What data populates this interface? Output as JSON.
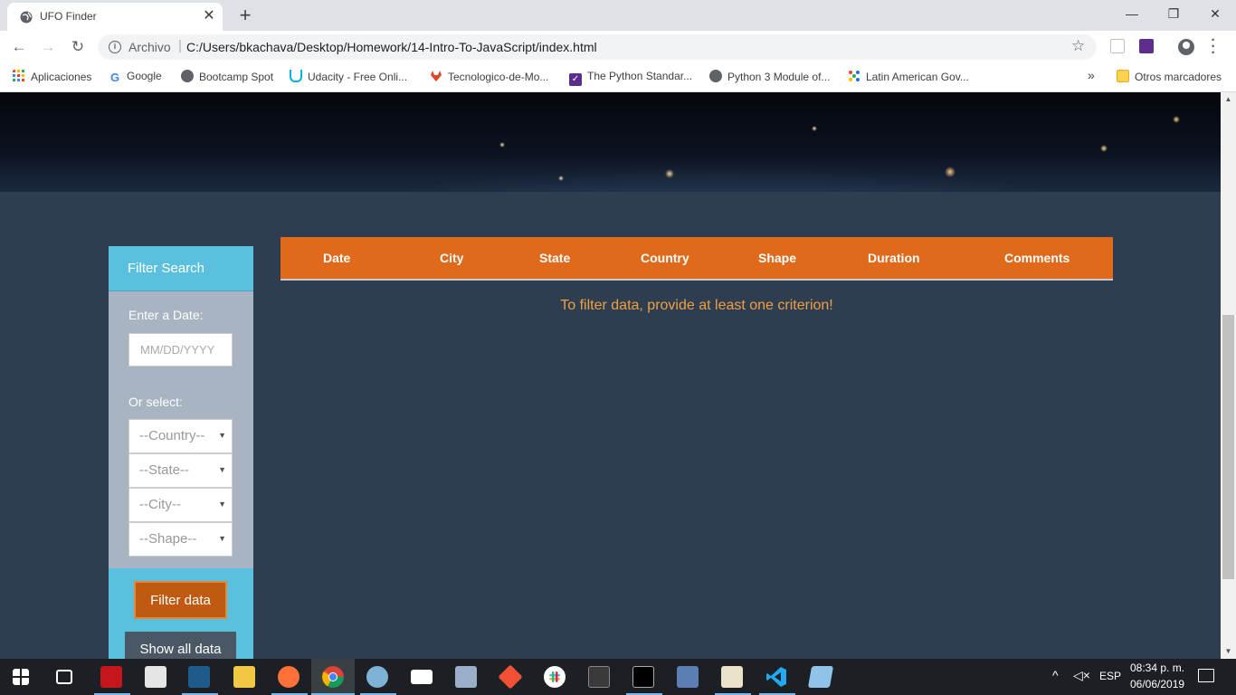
{
  "browser": {
    "tab_title": "UFO Finder",
    "tab_close": "✕",
    "new_tab": "+",
    "win_minimize": "—",
    "win_restore": "❐",
    "win_close": "✕",
    "address_scheme": "Archivo",
    "address_url": "C:/Users/bkachava/Desktop/Homework/14-Intro-To-JavaScript/index.html",
    "bookmarks": [
      {
        "label": "Aplicaciones",
        "icon": "apps-grid-icon",
        "color": "#ea4335"
      },
      {
        "label": "Google",
        "icon": "google-icon",
        "color": "#4285f4"
      },
      {
        "label": "Bootcamp Spot",
        "icon": "globe-icon",
        "color": "#5f6368"
      },
      {
        "label": "Udacity - Free Onli...",
        "icon": "udacity-icon",
        "color": "#02b3e4"
      },
      {
        "label": "Tecnologico-de-Mo...",
        "icon": "gitlab-icon",
        "color": "#e24329"
      },
      {
        "label": "The Python Standar...",
        "icon": "checkmark-icon",
        "color": "#5b2d8e"
      },
      {
        "label": "Python 3 Module of...",
        "icon": "globe-icon",
        "color": "#5f6368"
      },
      {
        "label": "Latin American Gov...",
        "icon": "dots-icon",
        "color": "#1a73e8"
      }
    ],
    "bookmarks_overflow": "»",
    "other_bookmarks": "Otros marcadores"
  },
  "filter": {
    "header": "Filter Search",
    "date_label": "Enter a Date:",
    "date_placeholder": "MM/DD/YYYY",
    "select_label": "Or select:",
    "selects": [
      "--Country--",
      "--State--",
      "--City--",
      "--Shape--"
    ],
    "filter_button": "Filter data",
    "show_all_button": "Show all data"
  },
  "table": {
    "headers": [
      "Date",
      "City",
      "State",
      "Country",
      "Shape",
      "Duration",
      "Comments"
    ],
    "empty_message": "To filter data, provide at least one criterion!"
  },
  "taskbar": {
    "language": "ESP",
    "time": "08:34 p. m.",
    "date": "06/06/2019"
  },
  "colors": {
    "page_bg": "#2e3e50",
    "header_orange": "#e06a1c",
    "panel_blue": "#5bc0de",
    "message_orange": "#f0a040"
  }
}
